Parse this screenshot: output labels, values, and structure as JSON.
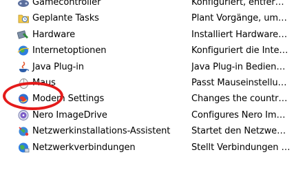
{
  "control_panel": {
    "items": [
      {
        "name": "Gamecontroller",
        "description": "Konfiguriert, entfer…",
        "icon": "gamecontroller-icon"
      },
      {
        "name": "Geplante Tasks",
        "description": "Plant Vorgänge, um…",
        "icon": "scheduled-tasks-icon"
      },
      {
        "name": "Hardware",
        "description": "Installiert Hardware…",
        "icon": "hardware-icon"
      },
      {
        "name": "Internetoptionen",
        "description": "Konfiguriert die Inte…",
        "icon": "internet-options-icon"
      },
      {
        "name": "Java Plug-in",
        "description": "Java Plug-in Bedien…",
        "icon": "java-icon"
      },
      {
        "name": "Maus",
        "description": "Passt Mauseinstellu…",
        "icon": "mouse-icon"
      },
      {
        "name": "Modem Settings",
        "description": "Changes the countr…",
        "icon": "modem-icon"
      },
      {
        "name": "Nero ImageDrive",
        "description": "Configures Nero Im…",
        "icon": "nero-imagedrive-icon"
      },
      {
        "name": "Netzwerkinstallations-Assistent",
        "description": "Startet den Netzwe…",
        "icon": "network-setup-wizard-icon"
      },
      {
        "name": "Netzwerkverbindungen",
        "description": "Stellt Verbindungen …",
        "icon": "network-connections-icon"
      }
    ]
  },
  "colors": {
    "annotation": "#e41b1b"
  }
}
